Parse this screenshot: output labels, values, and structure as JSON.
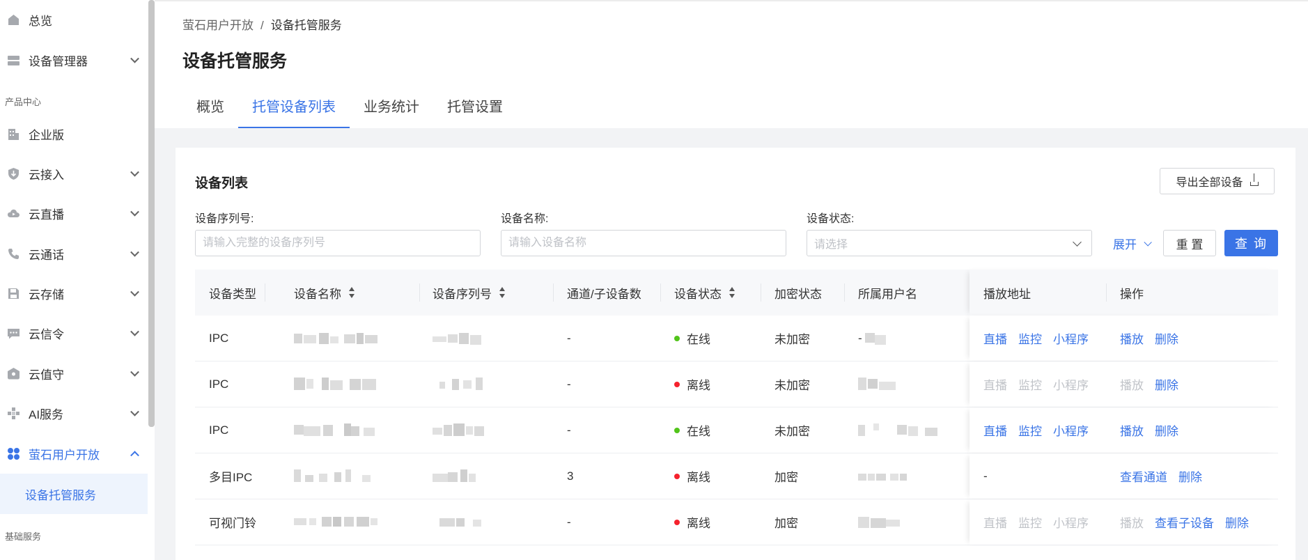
{
  "sidebar": {
    "items": [
      {
        "label": "总览",
        "icon": "home-icon"
      },
      {
        "label": "设备管理器",
        "icon": "server-icon"
      },
      {
        "label": "企业版",
        "icon": "building-icon"
      },
      {
        "label": "云接入",
        "icon": "shield-download-icon"
      },
      {
        "label": "云直播",
        "icon": "cloud-play-icon"
      },
      {
        "label": "云通话",
        "icon": "phone-icon"
      },
      {
        "label": "云存储",
        "icon": "save-icon"
      },
      {
        "label": "云信令",
        "icon": "message-icon"
      },
      {
        "label": "云值守",
        "icon": "shield-icon"
      },
      {
        "label": "AI服务",
        "icon": "ai-icon"
      },
      {
        "label": "萤石用户开放",
        "icon": "grid-icon"
      }
    ],
    "section_product": "产品中心",
    "section_basic": "基础服务",
    "sub_item": "设备托管服务"
  },
  "breadcrumb": {
    "parent": "萤石用户开放",
    "sep": "/",
    "current": "设备托管服务"
  },
  "page_title": "设备托管服务",
  "tabs": [
    "概览",
    "托管设备列表",
    "业务统计",
    "托管设置"
  ],
  "card": {
    "title": "设备列表",
    "export_label": "导出全部设备"
  },
  "filters": {
    "serial_label": "设备序列号:",
    "serial_placeholder": "请输入完整的设备序列号",
    "name_label": "设备名称:",
    "name_placeholder": "请输入设备名称",
    "status_label": "设备状态:",
    "status_placeholder": "请选择",
    "expand": "展开",
    "reset": "重 置",
    "query": "查 询"
  },
  "table": {
    "columns": [
      "设备类型",
      "设备名称",
      "设备序列号",
      "通道/子设备数",
      "设备状态",
      "加密状态",
      "所属用户名",
      "播放地址",
      "操作"
    ],
    "rows": [
      {
        "type": "IPC",
        "channels": "-",
        "status": "在线",
        "status_color": "#52c41a",
        "encrypt": "未加密",
        "user": "-",
        "play": [
          "直播",
          "监控",
          "小程序"
        ],
        "play_enabled": true,
        "ops": [
          "播放",
          "删除"
        ],
        "ops_enabled": [
          true,
          true
        ]
      },
      {
        "type": "IPC",
        "channels": "-",
        "status": "离线",
        "status_color": "#f5222d",
        "encrypt": "未加密",
        "user": "",
        "play": [
          "直播",
          "监控",
          "小程序"
        ],
        "play_enabled": false,
        "ops": [
          "播放",
          "删除"
        ],
        "ops_enabled": [
          false,
          true
        ]
      },
      {
        "type": "IPC",
        "channels": "-",
        "status": "在线",
        "status_color": "#52c41a",
        "encrypt": "未加密",
        "user": "",
        "play": [
          "直播",
          "监控",
          "小程序"
        ],
        "play_enabled": true,
        "ops": [
          "播放",
          "删除"
        ],
        "ops_enabled": [
          true,
          true
        ]
      },
      {
        "type": "多目IPC",
        "channels": "3",
        "status": "离线",
        "status_color": "#f5222d",
        "encrypt": "加密",
        "user": "",
        "play_text": "-",
        "ops": [
          "查看通道",
          "删除"
        ],
        "ops_enabled": [
          true,
          true
        ]
      },
      {
        "type": "可视门铃",
        "channels": "-",
        "status": "离线",
        "status_color": "#f5222d",
        "encrypt": "加密",
        "user": "",
        "play": [
          "直播",
          "监控",
          "小程序"
        ],
        "play_enabled": false,
        "ops": [
          "播放",
          "查看子设备",
          "删除"
        ],
        "ops_enabled": [
          false,
          true,
          true
        ]
      }
    ]
  }
}
